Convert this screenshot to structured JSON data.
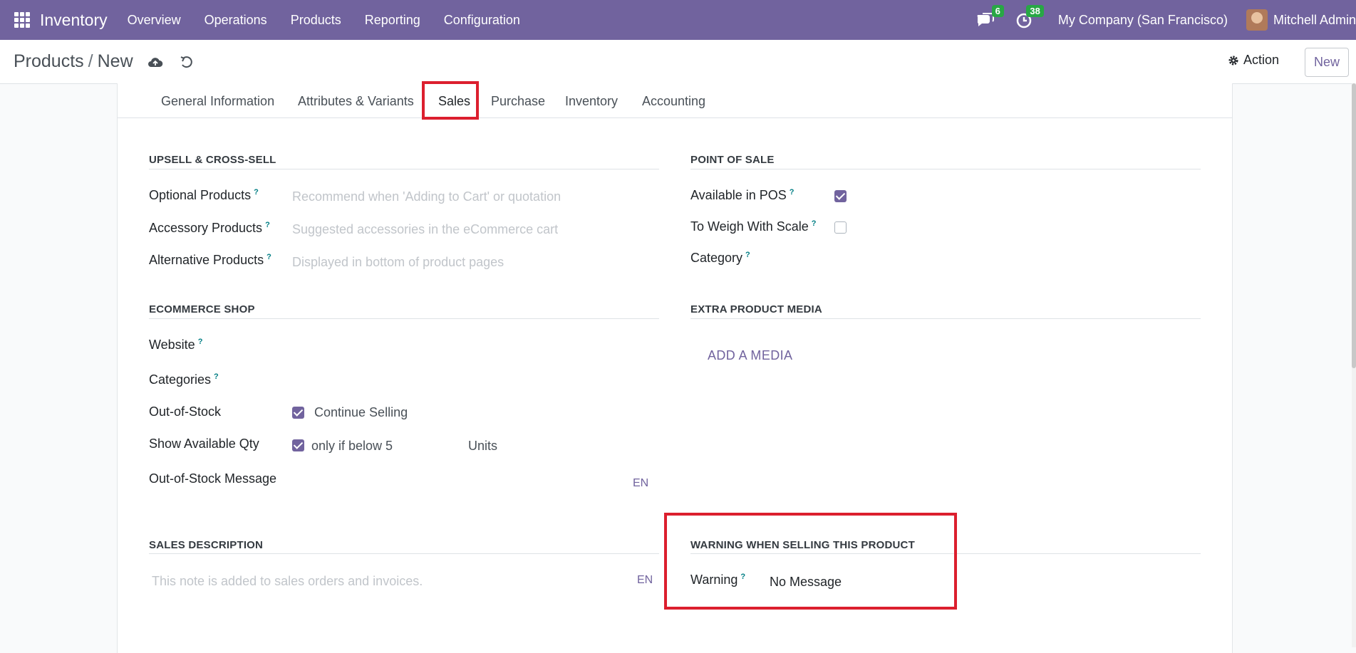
{
  "navbar": {
    "app_name": "Inventory",
    "menu": [
      "Overview",
      "Operations",
      "Products",
      "Reporting",
      "Configuration"
    ],
    "messages_count": "6",
    "activities_count": "38",
    "company": "My Company (San Francisco)",
    "user": "Mitchell Admin",
    "color": "#71639e"
  },
  "control": {
    "breadcrumb_parent": "Products",
    "breadcrumb_sep": "/",
    "breadcrumb_current": "New",
    "action_label": "Action",
    "new_label": "New"
  },
  "tabs": [
    "General Information",
    "Attributes & Variants",
    "Sales",
    "Purchase",
    "Inventory",
    "Accounting"
  ],
  "active_tab": "Sales",
  "upsell": {
    "title": "UPSELL & CROSS-SELL",
    "optional_label": "Optional Products",
    "optional_placeholder": "Recommend when 'Adding to Cart' or quotation",
    "accessory_label": "Accessory Products",
    "accessory_placeholder": "Suggested accessories in the eCommerce cart",
    "alternative_label": "Alternative Products",
    "alternative_placeholder": "Displayed in bottom of product pages"
  },
  "pos": {
    "title": "POINT OF SALE",
    "available_label": "Available in POS",
    "available_checked": true,
    "weigh_label": "To Weigh With Scale",
    "weigh_checked": false,
    "category_label": "Category"
  },
  "ecommerce": {
    "title": "ECOMMERCE SHOP",
    "website_label": "Website",
    "categories_label": "Categories",
    "oos_label": "Out-of-Stock",
    "oos_value": "Continue Selling",
    "show_qty_label": "Show Available Qty",
    "show_qty_value": "only if below 5",
    "show_qty_unit": "Units",
    "oos_message_label": "Out-of-Stock Message",
    "lang": "EN"
  },
  "media": {
    "title": "EXTRA PRODUCT MEDIA",
    "add_label": "ADD A MEDIA"
  },
  "sales_description": {
    "title": "SALES DESCRIPTION",
    "placeholder": "This note is added to sales orders and invoices.",
    "lang": "EN"
  },
  "warning": {
    "title": "WARNING WHEN SELLING THIS PRODUCT",
    "label": "Warning",
    "value": "No Message"
  },
  "help_mark": "?",
  "highlight_color": "#dc1f2e"
}
